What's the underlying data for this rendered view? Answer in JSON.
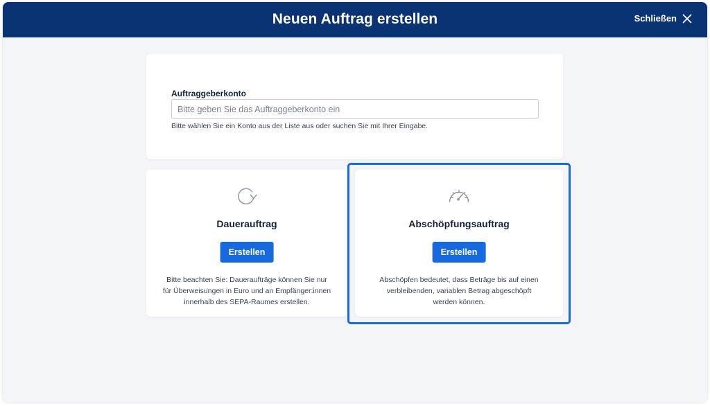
{
  "header": {
    "title": "Neuen Auftrag erstellen",
    "close_label": "Schließen",
    "close_icon": "close-icon"
  },
  "account": {
    "label": "Auftraggeberkonto",
    "placeholder": "Bitte geben Sie das Auftraggeberkonto ein",
    "value": "",
    "hint": "Bitte wählen Sie ein Konto aus der Liste aus oder suchen Sie mit Ihrer Eingabe."
  },
  "options": [
    {
      "icon": "refresh-icon",
      "title": "Dauerauftrag",
      "button_label": "Erstellen",
      "description_lines": [
        "Bitte beachten Sie: Daueraufträge können Sie nur",
        "für Überweisungen in Euro und an Empfänger:innen",
        "innerhalb des SEPA-Raumes erstellen."
      ]
    },
    {
      "icon": "gauge-icon",
      "title": "Abschöpfungsauftrag",
      "button_label": "Erstellen",
      "selected": true,
      "description_lines": [
        "Abschöpfen bedeutet, dass Beträge bis auf einen",
        "verbleibenden, variablen Betrag abgeschöpft",
        "werden können."
      ]
    }
  ],
  "colors": {
    "header_bg": "#0a3373",
    "accent": "#1769e0",
    "page_bg": "#f3f5f9",
    "text_dark": "#14233c"
  }
}
